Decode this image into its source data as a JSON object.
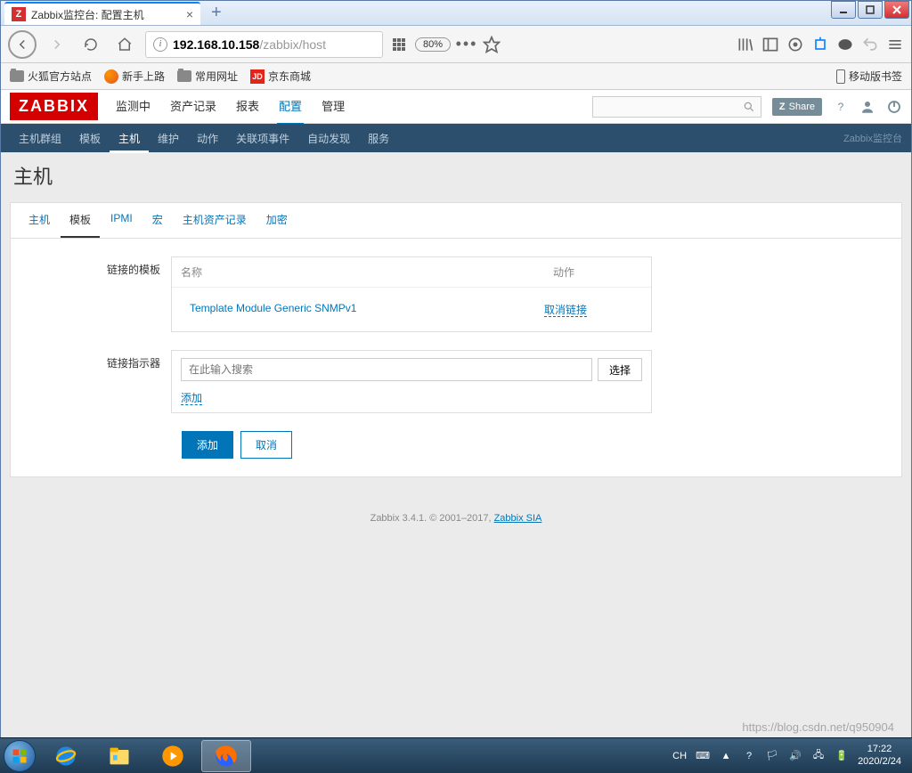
{
  "browser": {
    "tab_title": "Zabbix监控台: 配置主机",
    "tab_favicon": "Z",
    "url_host": "192.168.10.158",
    "url_path": "/zabbix/host",
    "zoom": "80%"
  },
  "bookmarks": {
    "items": [
      "火狐官方站点",
      "新手上路",
      "常用网址",
      "京东商城"
    ],
    "mobile": "移动版书签"
  },
  "zabbix": {
    "logo": "ZABBIX",
    "nav": [
      "监测中",
      "资产记录",
      "报表",
      "配置",
      "管理"
    ],
    "nav_active": "配置",
    "share": "Share",
    "subnav": [
      "主机群组",
      "模板",
      "主机",
      "维护",
      "动作",
      "关联项事件",
      "自动发现",
      "服务"
    ],
    "subnav_active": "主机",
    "breadcrumb": "Zabbix监控台",
    "page_title": "主机",
    "inner_tabs": [
      "主机",
      "模板",
      "IPMI",
      "宏",
      "主机资产记录",
      "加密"
    ],
    "inner_tab_active": "模板",
    "form": {
      "linked_templates_label": "链接的模板",
      "col_name": "名称",
      "col_action": "动作",
      "template_name": "Template Module Generic SNMPv1",
      "unlink": "取消链接",
      "link_indicator_label": "链接指示器",
      "search_placeholder": "在此输入搜索",
      "select_btn": "选择",
      "add_link": "添加",
      "submit": "添加",
      "cancel": "取消"
    },
    "footer": {
      "version": "Zabbix 3.4.1. © 2001–2017, ",
      "company": "Zabbix SIA"
    }
  },
  "taskbar": {
    "ime": "CH",
    "time": "17:22",
    "date": "2020/2/24"
  },
  "watermark": "https://blog.csdn.net/q950904"
}
